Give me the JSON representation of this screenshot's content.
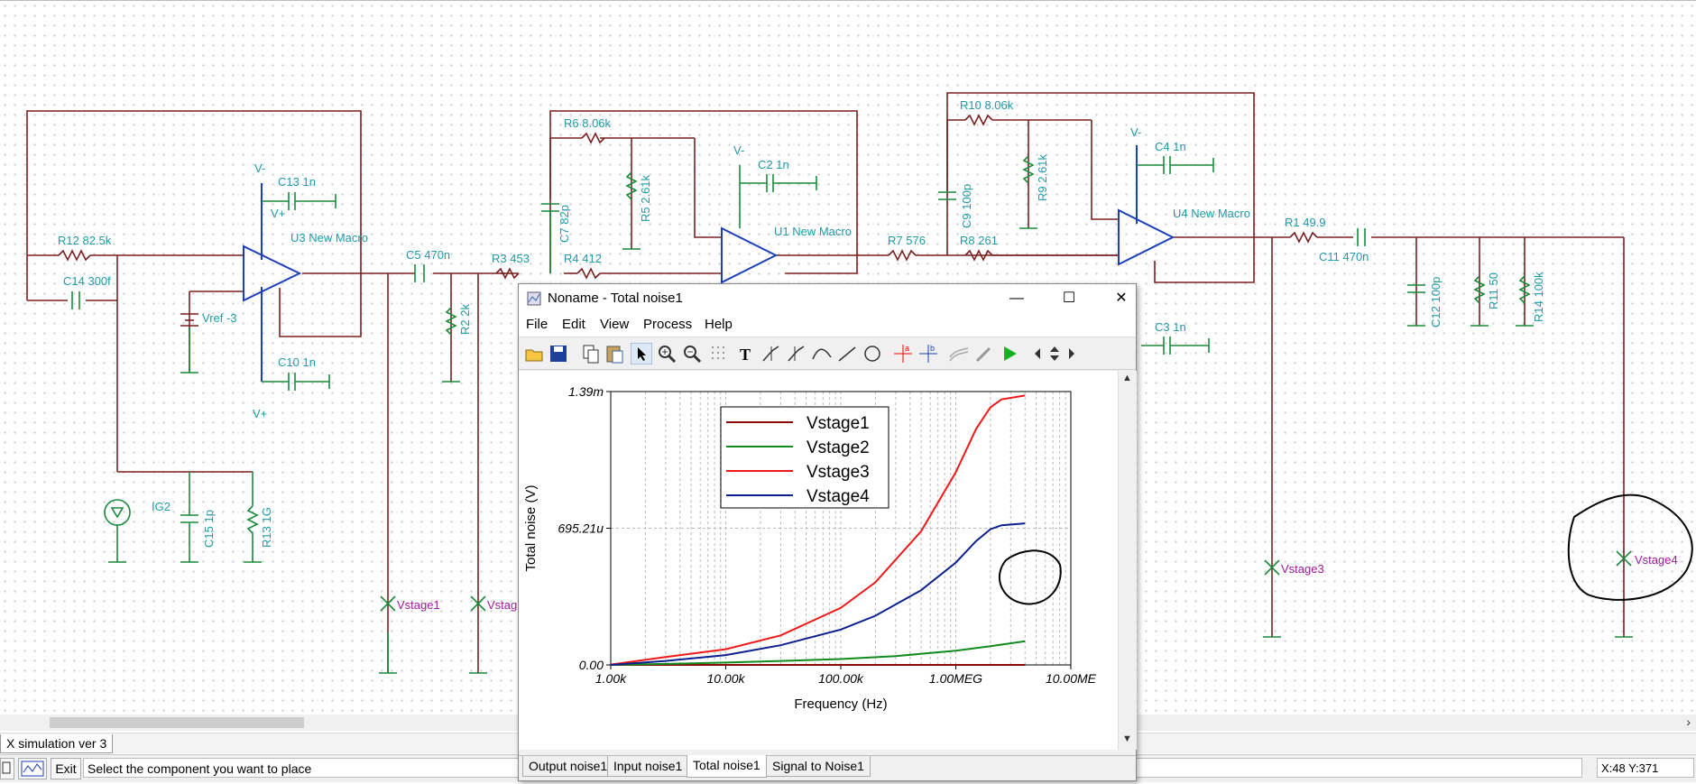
{
  "schematic": {
    "labels": {
      "r12": "R12 82.5k",
      "c14": "C14 300f",
      "c13": "C13 1n",
      "u3": "U3 New Macro",
      "vminus1": "V-",
      "vplus1": "V+",
      "vplus2": "V+",
      "vref": "Vref -3",
      "c10": "C10 1n",
      "ig2": "IG2",
      "c15": "C15 1p",
      "r13": "R13 1G",
      "c5": "C5 470n",
      "r2": "R2 2k",
      "r3": "R3 453",
      "r6": "R6 8.06k",
      "r5": "R5 2.61k",
      "c7": "C7 82p",
      "r4": "R4 412",
      "vminus2": "V-",
      "c2": "C2 1n",
      "u1": "U1 New Macro",
      "r7": "R7 576",
      "r10": "R10 8.06k",
      "c9": "C9 100p",
      "r9": "R9 2.61k",
      "r8": "R8 261",
      "vminus3": "V-",
      "c4": "C4 1n",
      "u4": "U4 New Macro",
      "c3": "C3 1n",
      "r1": "R1 49.9",
      "c11": "C11 470n",
      "c12": "C12 100p",
      "r11": "R11 50",
      "r14": "R14 100k",
      "vstage1": "Vstage1",
      "vstage2": "Vstag",
      "vstage3": "Vstage3",
      "vstage4": "Vstage4"
    }
  },
  "window": {
    "title": "Noname - Total noise1",
    "controls": {
      "minimize": "—",
      "maximize": "☐",
      "close": "✕"
    },
    "menu": [
      "File",
      "Edit",
      "View",
      "Process",
      "Help"
    ],
    "toolbar_icons": [
      "open-icon",
      "save-icon",
      "copy-icon",
      "paste-icon",
      "pointer-icon",
      "zoom-in-icon",
      "zoom-out-icon",
      "grid-icon",
      "text-icon",
      "cursor-a-icon",
      "cursor-b-icon",
      "curve-icon",
      "line-icon",
      "circle-icon",
      "marker-a-icon",
      "marker-b-icon",
      "fit-icon",
      "pen-icon",
      "run-icon",
      "scroll-arrows-icon"
    ],
    "tabs": [
      "Output noise1",
      "Input noise1",
      "Total noise1",
      "Signal to Noise1"
    ],
    "active_tab": "Total noise1"
  },
  "chart_data": {
    "type": "line",
    "xlabel": "Frequency (Hz)",
    "ylabel": "Total noise (V)",
    "x_scale": "log",
    "xlim": [
      1000,
      10000000
    ],
    "x_ticks": [
      "1.00k",
      "10.00k",
      "100.00k",
      "1.00MEG",
      "10.00ME"
    ],
    "ylim": [
      0,
      0.00139
    ],
    "y_ticks": [
      "0.00",
      "695.21u",
      "1.39m"
    ],
    "grid": true,
    "legend_position": "top-center",
    "series": [
      {
        "name": "Vstage1",
        "color": "#8b0a0a",
        "x": [
          1000,
          4000000
        ],
        "y": [
          0,
          0
        ]
      },
      {
        "name": "Vstage2",
        "color": "#118a1e",
        "x": [
          1000,
          3000,
          10000,
          30000,
          100000,
          300000,
          1000000,
          2000000,
          4000000
        ],
        "y": [
          0,
          5e-06,
          1.2e-05,
          2e-05,
          3e-05,
          4.5e-05,
          7.2e-05,
          9.5e-05,
          0.00012
        ]
      },
      {
        "name": "Vstage3",
        "color": "#f01818",
        "x": [
          1000,
          3000,
          10000,
          30000,
          100000,
          200000,
          500000,
          1000000,
          1500000,
          2000000,
          2500000,
          4000000
        ],
        "y": [
          2e-06,
          4e-05,
          8e-05,
          0.00015,
          0.00029,
          0.00042,
          0.00068,
          0.00098,
          0.0012,
          0.00131,
          0.00135,
          0.00137
        ]
      },
      {
        "name": "Vstage4",
        "color": "#0b1f8f",
        "x": [
          1000,
          3000,
          10000,
          30000,
          100000,
          200000,
          500000,
          1000000,
          1500000,
          2000000,
          2500000,
          4000000
        ],
        "y": [
          0,
          2e-05,
          5e-05,
          0.0001,
          0.00018,
          0.00025,
          0.00038,
          0.00052,
          0.00063,
          0.00069,
          0.00071,
          0.00072
        ]
      }
    ]
  },
  "bottom": {
    "doc_tab": "X simulation ver 3",
    "exit_label": "Exit",
    "status_message": "Select the component you want to place",
    "coords": "X:48 Y:371"
  }
}
